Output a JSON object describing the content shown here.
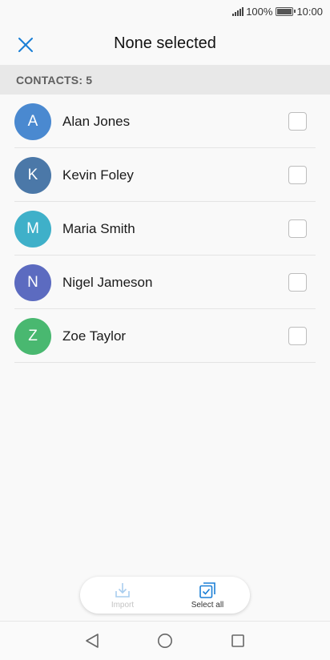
{
  "status_bar": {
    "battery": "100%",
    "time": "10:00"
  },
  "header": {
    "title": "None selected",
    "close_icon": "close-icon"
  },
  "section": {
    "label": "CONTACTS: 5"
  },
  "contacts": [
    {
      "initial": "A",
      "name": "Alan Jones",
      "color": "#4a89d0",
      "checked": false
    },
    {
      "initial": "K",
      "name": "Kevin Foley",
      "color": "#4b78a8",
      "checked": false
    },
    {
      "initial": "M",
      "name": "Maria Smith",
      "color": "#3fb0c9",
      "checked": false
    },
    {
      "initial": "N",
      "name": "Nigel Jameson",
      "color": "#5c6bc0",
      "checked": false
    },
    {
      "initial": "Z",
      "name": "Zoe Taylor",
      "color": "#49b870",
      "checked": false
    }
  ],
  "actions": {
    "import_label": "Import",
    "select_all_label": "Select all",
    "import_enabled": false
  },
  "colors": {
    "accent": "#1a7fd6",
    "section_bg": "#e8e8e8"
  },
  "nav": {
    "back_icon": "back-triangle-icon",
    "home_icon": "home-circle-icon",
    "recents_icon": "recents-square-icon"
  }
}
